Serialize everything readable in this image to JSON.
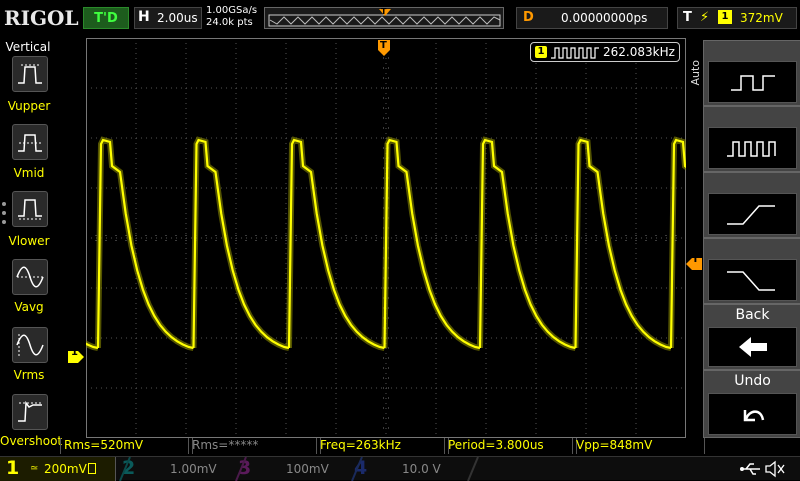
{
  "brand": "RIGOL",
  "run_status": "T'D",
  "horizontal": {
    "key": "H",
    "timebase": "2.00us"
  },
  "sample": {
    "rate": "1.00GSa/s",
    "points": "24.0k pts"
  },
  "memory_trigger_marker": "T",
  "delay": {
    "key": "D",
    "value": "0.00000000ps"
  },
  "trigger": {
    "key": "T",
    "edge": "⚡",
    "source": "1",
    "level": "372mV"
  },
  "left_panel": {
    "title": "Vertical",
    "items": [
      "Vupper",
      "Vmid",
      "Vlower",
      "Vavg",
      "Vrms",
      "Overshoot"
    ]
  },
  "freq_counter": {
    "channel": "1",
    "value": "262.083kHz"
  },
  "trigger_marker": "T",
  "level_marker": "T",
  "ch1_marker": "1",
  "right_menu": {
    "mode": "Auto",
    "back_label": "Back",
    "undo_label": "Undo"
  },
  "measurements": [
    "Rms=520mV",
    "Rms=*****",
    "Freq=263kHz",
    "Period=3.800us",
    "Vpp=848mV"
  ],
  "channels": [
    {
      "num": "1",
      "scale": "200mV",
      "color": "#ffff00"
    },
    {
      "num": "2",
      "scale": "1.00mV",
      "color": "#00cccc"
    },
    {
      "num": "3",
      "scale": "100mV",
      "color": "#cc33cc"
    },
    {
      "num": "4",
      "scale": "10.0 V",
      "color": "#3366ff"
    }
  ],
  "colors": {
    "ch1": "#ffff00",
    "accent": "#ff9900",
    "status": "#3fff3f"
  },
  "status_icons": [
    "usb-icon",
    "mute-icon"
  ]
}
